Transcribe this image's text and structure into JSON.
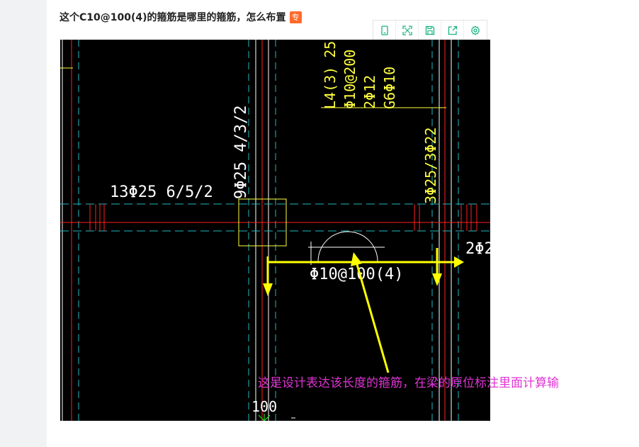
{
  "post": {
    "title": "这个C10@100(4)的箍筋是哪里的箍筋，怎么布置",
    "badge": "专"
  },
  "toolbar": {
    "buttons": [
      {
        "icon": "mobile-icon"
      },
      {
        "icon": "fullscreen-icon"
      },
      {
        "icon": "save-icon"
      },
      {
        "icon": "share-icon"
      },
      {
        "icon": "settings-icon"
      }
    ]
  },
  "drawing": {
    "beam_label_left": "13Φ25 6/5/2",
    "column_label": "9Φ25 4/3/2",
    "beam_label_top_1": "L4(3) 25",
    "beam_label_top_2": "Φ10@200",
    "beam_label_top_3": "2Φ12",
    "beam_label_top_4": "G6Φ10",
    "beam_label_right": "3Φ25/3Φ22",
    "right_edge_label": "2Φ2",
    "stirrup_label": "Φ10@100(4)",
    "bottom_label": "100",
    "colors": {
      "background": "#000000",
      "axis_red": "#ff2020",
      "dash_cyan": "#20b8c0",
      "wall_white": "#ffffff",
      "text_yellow": "#ffff40",
      "arrow_yellow": "#ffff00",
      "green": "#20e020"
    }
  },
  "annotation": {
    "text": "这是设计表达该长度的箍筋，在梁的原位标注里面计算输",
    "color": "#e034d4"
  }
}
